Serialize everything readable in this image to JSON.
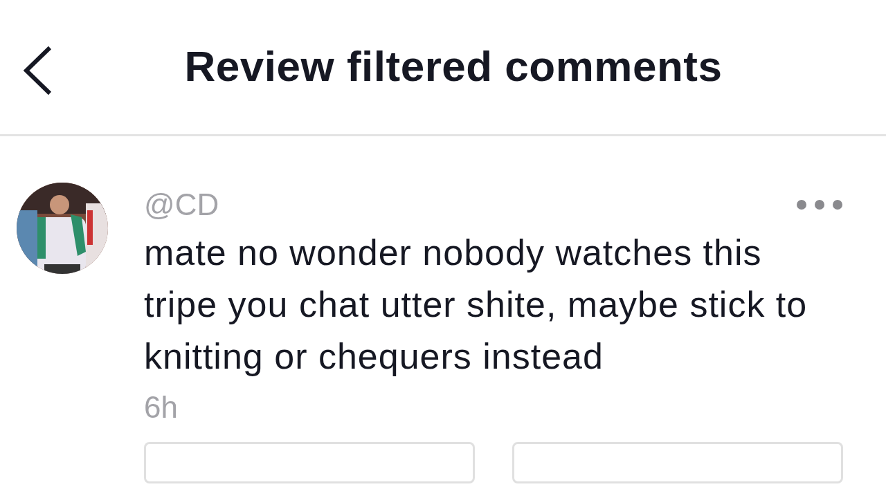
{
  "header": {
    "title": "Review filtered comments"
  },
  "comment": {
    "username": "@CD",
    "text": "mate no wonder nobody watches this tripe you chat utter shite, maybe stick to knitting or chequers instead",
    "time": "6h"
  },
  "actions": [
    {
      "kind": "outlined"
    },
    {
      "kind": "outlined"
    }
  ]
}
